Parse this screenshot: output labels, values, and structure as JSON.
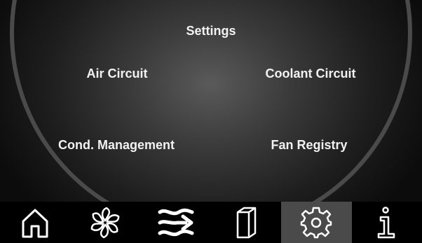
{
  "screen": {
    "title": "Settings"
  },
  "menu": {
    "air_circuit": "Air Circuit",
    "coolant_circuit": "Coolant Circuit",
    "cond_management": "Cond. Management",
    "fan_registry": "Fan Registry"
  },
  "navbar": {
    "items": [
      {
        "icon": "home-icon",
        "active": false
      },
      {
        "icon": "fan-icon",
        "active": false
      },
      {
        "icon": "airflow-icon",
        "active": false
      },
      {
        "icon": "door-icon",
        "active": false
      },
      {
        "icon": "gear-icon",
        "active": true
      },
      {
        "icon": "info-icon",
        "active": false
      }
    ],
    "active_color": "#4a4a4a"
  },
  "colors": {
    "text": "#f2f2f2",
    "ring": "#4a4a4a",
    "background": "#000000"
  }
}
